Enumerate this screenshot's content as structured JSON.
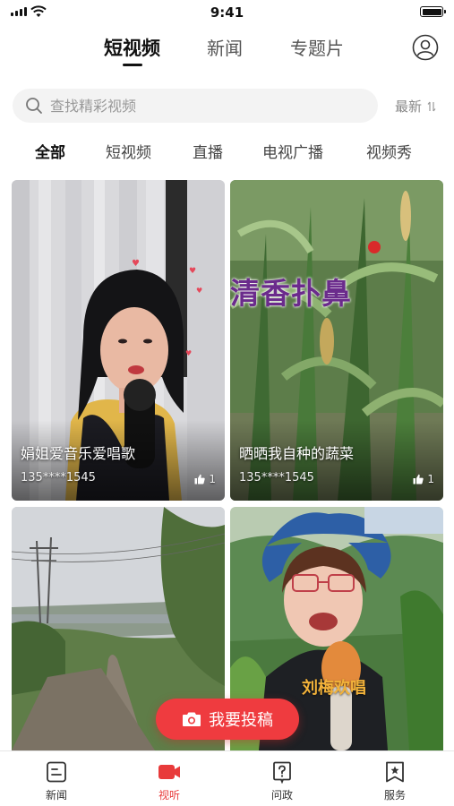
{
  "status_bar": {
    "time": "9:41"
  },
  "top_tabs": [
    {
      "label": "短视频",
      "active": true
    },
    {
      "label": "新闻",
      "active": false
    },
    {
      "label": "专题片",
      "active": false
    }
  ],
  "search": {
    "placeholder": "查找精彩视频",
    "sort_label": "最新"
  },
  "categories": [
    {
      "label": "全部",
      "active": true
    },
    {
      "label": "短视频",
      "active": false
    },
    {
      "label": "直播",
      "active": false
    },
    {
      "label": "电视广播",
      "active": false
    },
    {
      "label": "视频秀",
      "active": false
    }
  ],
  "videos": [
    {
      "title": "娟姐爱音乐爱唱歌",
      "author": "135****1545",
      "likes": "1",
      "overlay_text": ""
    },
    {
      "title": "晒晒我自种的蔬菜",
      "author": "135****1545",
      "likes": "1",
      "overlay_text": "清香扑鼻"
    },
    {
      "title": "",
      "author": "",
      "likes": "",
      "overlay_text": ""
    },
    {
      "title": "",
      "author": "",
      "likes": "",
      "overlay_text": "刘梅欢唱"
    }
  ],
  "submit_button": {
    "label": "我要投稿"
  },
  "bottom_nav": [
    {
      "label": "新闻",
      "icon": "news-icon",
      "active": false
    },
    {
      "label": "视听",
      "icon": "video-icon",
      "active": true
    },
    {
      "label": "问政",
      "icon": "question-icon",
      "active": false
    },
    {
      "label": "服务",
      "icon": "service-icon",
      "active": false
    }
  ],
  "colors": {
    "accent": "#ef3b3f",
    "active_nav": "#e83a3a"
  }
}
